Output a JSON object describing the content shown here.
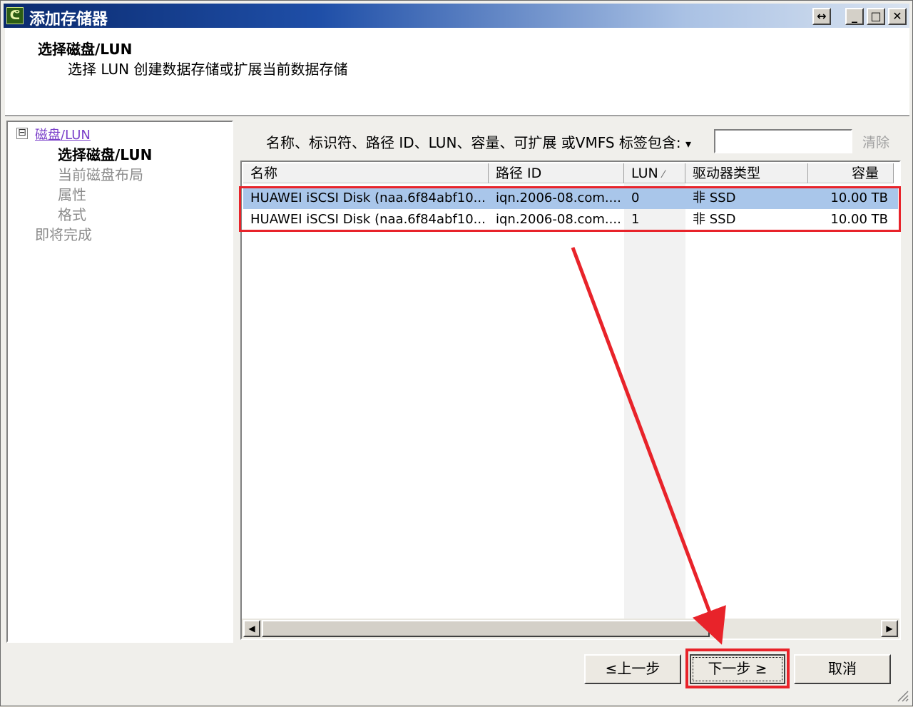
{
  "window": {
    "title": "添加存储器",
    "controls": {
      "restore": "↔",
      "minimize": "_",
      "maximize": "□",
      "close": "✕"
    }
  },
  "header": {
    "title": "选择磁盘/LUN",
    "subtitle": "选择 LUN 创建数据存储或扩展当前数据存储"
  },
  "nav": {
    "expander": "⊟",
    "root_link": "磁盘/LUN",
    "items": [
      {
        "label": "选择磁盘/LUN",
        "current": true
      },
      {
        "label": "当前磁盘布局",
        "current": false
      },
      {
        "label": "属性",
        "current": false
      },
      {
        "label": "格式",
        "current": false
      }
    ],
    "finish": "即将完成"
  },
  "filter": {
    "label": "名称、标识符、路径 ID、LUN、容量、可扩展 或VMFS 标签包含:",
    "dropdown_arrow": "▾",
    "value": "",
    "clear_label": "清除"
  },
  "table": {
    "columns": [
      "名称",
      "路径 ID",
      "LUN",
      "驱动器类型",
      "容量"
    ],
    "sort_indicator": "⁄",
    "rows": [
      {
        "name": "HUAWEI iSCSI Disk (naa.6f84abf10...",
        "path": "iqn.2006-08.com....",
        "lun": "0",
        "drive": "非 SSD",
        "capacity": "10.00 TB",
        "selected": true
      },
      {
        "name": "HUAWEI iSCSI Disk (naa.6f84abf10...",
        "path": "iqn.2006-08.com....",
        "lun": "1",
        "drive": "非 SSD",
        "capacity": "10.00 TB",
        "selected": false
      }
    ]
  },
  "scrollbar": {
    "left": "◀",
    "right": "▶"
  },
  "buttons": {
    "back": "≤上一步",
    "next": "下一步 ≥",
    "cancel": "取消"
  },
  "colors": {
    "annotation_red": "#e8232a",
    "selected_row": "#a9c6ea",
    "title_bar": "#0a2a6e"
  }
}
